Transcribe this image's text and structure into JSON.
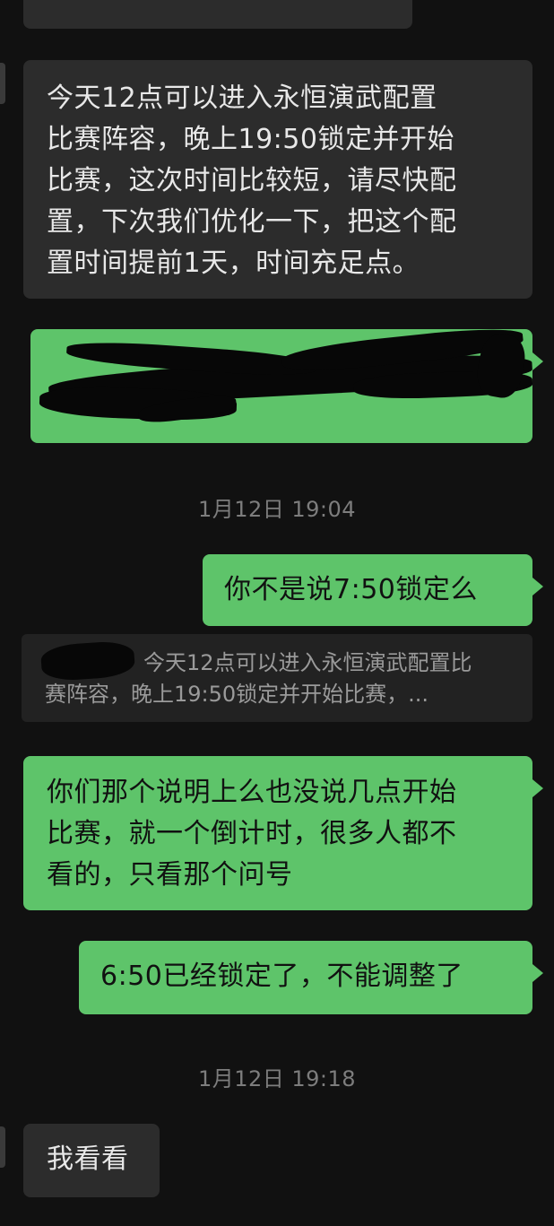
{
  "messages": {
    "incoming_1_text": "今天12点可以进入永恒演武配置\n比赛阵容，晚上19:50锁定并开始\n比赛，这次时间比较短，请尽快配\n置，下次我们优化一下，把这个配\n置时间提前1天，时间充足点。",
    "outgoing_1_text": "你不是说7:50锁定么",
    "outgoing_2_text": "你们那个说明上么也没说几点开始\n比赛，就一个倒计时，很多人都不\n看的，只看那个问号",
    "outgoing_3_text": "6:50已经锁定了，不能调整了",
    "incoming_2_text": "我看看"
  },
  "quote": {
    "line1": "今天12点可以进入永恒演武配置比",
    "line2": "赛阵容，晚上19:50锁定并开始比赛，..."
  },
  "timestamps": {
    "first": "1月12日 19:04",
    "second": "1月12日 19:18"
  },
  "colors": {
    "background": "#111111",
    "incoming_bubble": "#2c2c2c",
    "outgoing_bubble": "#5ec46a",
    "timestamp_text": "#7d7d7d"
  }
}
